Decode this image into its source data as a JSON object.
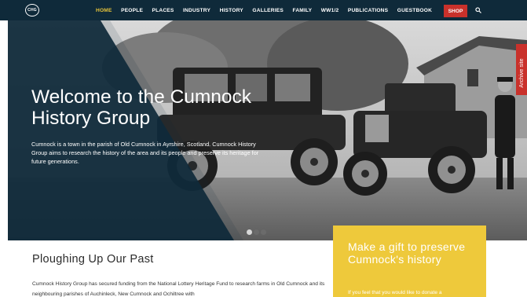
{
  "header": {
    "logo_text": "CHG",
    "nav": [
      {
        "label": "HOME",
        "active": true
      },
      {
        "label": "PEOPLE"
      },
      {
        "label": "PLACES"
      },
      {
        "label": "INDUSTRY"
      },
      {
        "label": "HISTORY"
      },
      {
        "label": "GALLERIES"
      },
      {
        "label": "FAMILY"
      },
      {
        "label": "WW1/2"
      },
      {
        "label": "PUBLICATIONS"
      },
      {
        "label": "GUESTBOOK"
      }
    ],
    "shop_label": "SHOP",
    "search_icon": "search-icon"
  },
  "hero": {
    "title": "Welcome to the Cumnock History Group",
    "text": "Cumnock is a town in the parish of Old Cumnock in Ayrshire, Scotland. Cumnock History Group aims to research the history of the area and its people and preserve its heritage for future generations.",
    "slide_count": 3,
    "active_slide": 1
  },
  "archive_tab": {
    "label": "Archive site"
  },
  "main": {
    "title": "Ploughing Up Our Past",
    "text": "Cumnock History Group has secured funding from the National Lottery Heritage Fund to research farms in Old Cumnock and its neighbouring parishes of Auchinleck, New Cumnock and Ochiltree with"
  },
  "gift": {
    "title": "Make a gift to preserve Cumnock's history",
    "text": "If you feel that you would like to donate a"
  },
  "colors": {
    "nav_bg": "#0f2a3a",
    "nav_active": "#e6c33a",
    "shop_bg": "#c9312b",
    "hero_overlay": "#0f2a3a",
    "gift_bg": "#eec93b"
  }
}
